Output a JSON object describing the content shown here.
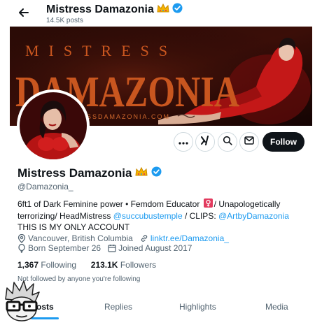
{
  "header": {
    "name": "Mistress Damazonia",
    "posts": "14.5K posts"
  },
  "banner": {
    "line1": "MISTRESS",
    "line2": "DAMAZONIA",
    "url": "SSDAMAZONIA.COM"
  },
  "actions": {
    "follow_label": "Follow"
  },
  "profile": {
    "name": "Mistress Damazonia",
    "handle": "@Damazonia_",
    "bio": {
      "part1": "6ft1 of Dark Feminine power • Femdom Educator",
      "part2": "/ Unapologetically terrorizing/ HeadMistress",
      "mention1": "@succubustemple",
      "part3": "/ CLIPS:",
      "mention2": "@ArtbyDamazonia",
      "part4": "THIS IS MY ONLY ACCOUNT"
    },
    "location": "Vancouver, British Columbia",
    "website": "linktr.ee/Damazonia_",
    "born": "Born September 26",
    "joined": "Joined August 2017",
    "following_count": "1,367",
    "following_label": "Following",
    "followers_count": "213.1K",
    "followers_label": "Followers",
    "not_followed": "Not followed by anyone you're following"
  },
  "tabs": [
    {
      "label": "Posts"
    },
    {
      "label": "Replies"
    },
    {
      "label": "Highlights"
    },
    {
      "label": "Media"
    }
  ],
  "colors": {
    "accent": "#1d9bf0",
    "text": "#0f1419",
    "muted": "#536471",
    "banner_text": "#c9561f"
  },
  "icons": [
    "back-arrow-icon",
    "crown-icon",
    "verified-badge-icon",
    "more-icon",
    "grok-icon",
    "search-icon",
    "message-icon",
    "location-icon",
    "link-icon",
    "balloon-icon",
    "calendar-icon",
    "female-sign-icon"
  ]
}
